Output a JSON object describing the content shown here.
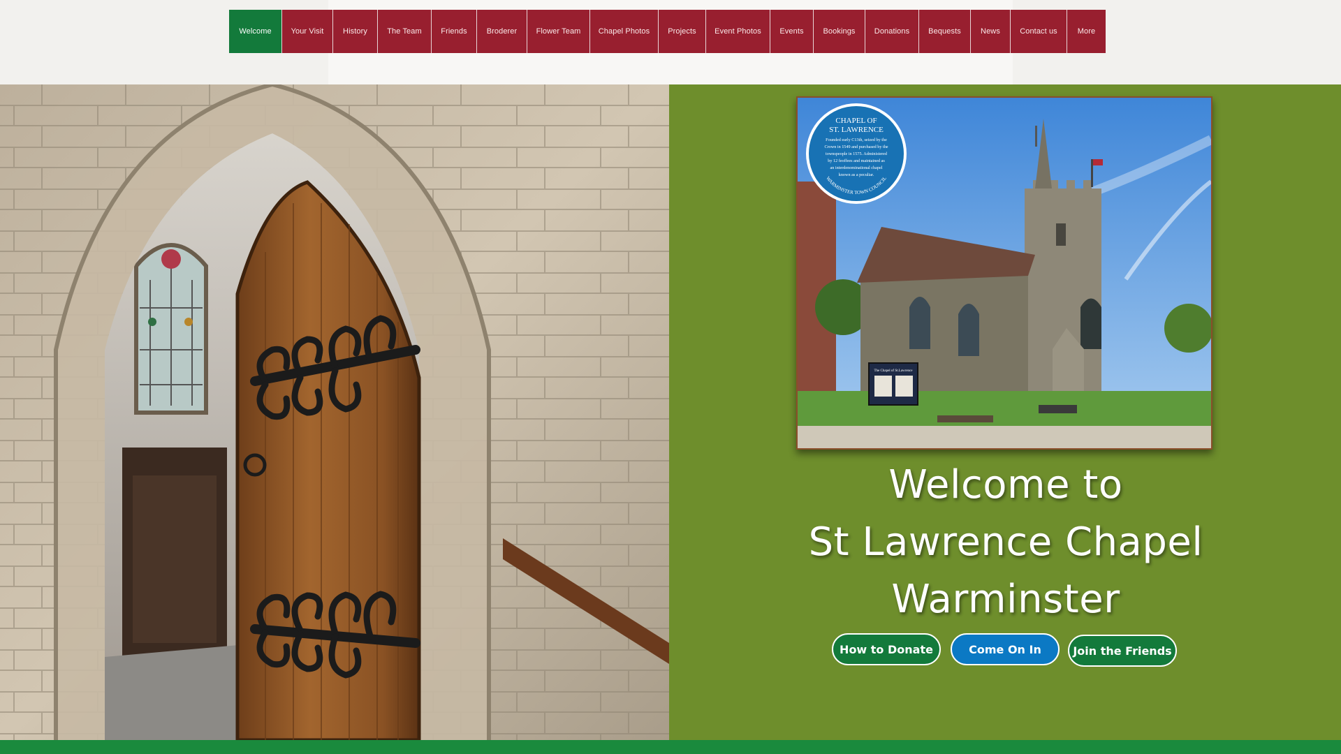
{
  "nav": {
    "items": [
      {
        "label": "Welcome",
        "active": true
      },
      {
        "label": "Your Visit"
      },
      {
        "label": "History"
      },
      {
        "label": "The Team"
      },
      {
        "label": "Friends"
      },
      {
        "label": "Broderer"
      },
      {
        "label": "Flower Team"
      },
      {
        "label": "Chapel Photos"
      },
      {
        "label": "Projects"
      },
      {
        "label": "Event Photos"
      },
      {
        "label": "Events"
      },
      {
        "label": "Bookings"
      },
      {
        "label": "Donations"
      },
      {
        "label": "Bequests"
      },
      {
        "label": "News"
      },
      {
        "label": "Contact us"
      },
      {
        "label": "More"
      }
    ]
  },
  "plaque": {
    "title_line1": "CHAPEL OF",
    "title_line2": "ST. LAWRENCE",
    "body": [
      "Founded early C13th, seized by the",
      "Crown in 1549 and purchased by the",
      "townspeople in 1575. Administered",
      "by 12 feoffees and maintained as",
      "an interdenominational chapel",
      "known as a peculiar."
    ],
    "footer": "WARMINSTER TOWN COUNCIL"
  },
  "noticeboard": "The Chapel of St.Lawrence",
  "welcome": {
    "line1": "Welcome to",
    "line2": "St Lawrence Chapel",
    "line3": "Warminster"
  },
  "buttons": {
    "donate": "How to Donate",
    "come_in": "Come On In",
    "friends": "Join the Friends"
  },
  "colors": {
    "nav_red": "#981f2f",
    "nav_active_green": "#137a3b",
    "panel_green": "#6e8e2c",
    "button_blue": "#0b79c4",
    "footer_green": "#1a8a3d"
  }
}
